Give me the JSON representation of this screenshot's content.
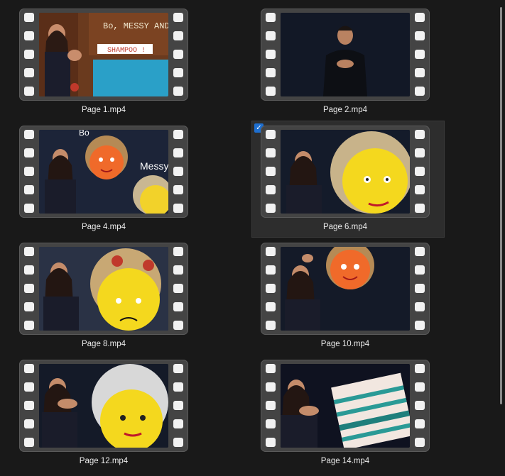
{
  "files": [
    {
      "name": "Page 1.mp4",
      "selected": false
    },
    {
      "name": "Page 2.mp4",
      "selected": false
    },
    {
      "name": "Page 4.mp4",
      "selected": false
    },
    {
      "name": "Page 6.mp4",
      "selected": true
    },
    {
      "name": "Page 8.mp4",
      "selected": false
    },
    {
      "name": "Page 10.mp4",
      "selected": false
    },
    {
      "name": "Page 12.mp4",
      "selected": false
    },
    {
      "name": "Page 14.mp4",
      "selected": false
    }
  ],
  "thumb_text": {
    "page1_sign": "Bo, MESSY AND",
    "page1_sign2": "SHAMPOO !",
    "page4_bo": "Bo",
    "page4_messy": "Messy"
  },
  "colors": {
    "background": "#191919",
    "film": "#444444",
    "selection": "#2d2d2d",
    "checkbox": "#1e6fd0"
  },
  "icons": {
    "checkbox": "checkmark-icon",
    "film_frame": "film-strip-icon"
  }
}
